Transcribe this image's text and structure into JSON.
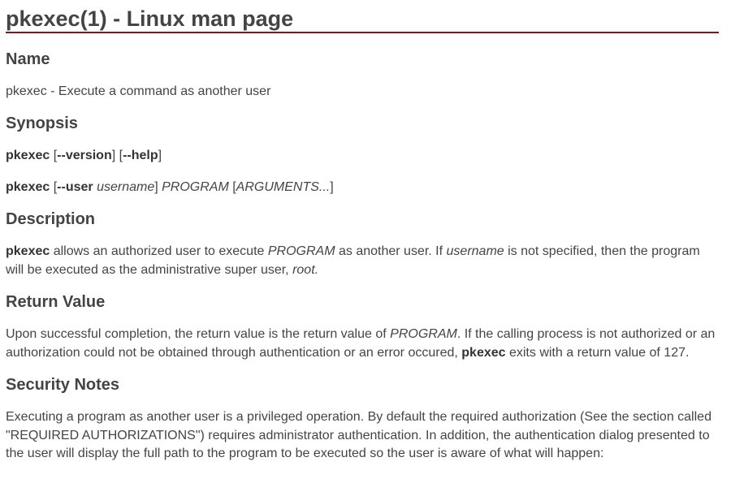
{
  "title": "pkexec(1) - Linux man page",
  "sections": {
    "name": {
      "heading": "Name",
      "text": "pkexec - Execute a command as another user"
    },
    "synopsis": {
      "heading": "Synopsis",
      "line1": {
        "cmd": "pkexec",
        "open1": " [",
        "opt1": "--version",
        "mid": "] [",
        "opt2": "--help",
        "close": "]"
      },
      "line2": {
        "cmd": "pkexec",
        "open1": " [",
        "opt_user": "--user",
        "space": " ",
        "arg_username": "username",
        "close1": "] ",
        "arg_program": "PROGRAM",
        "open2": " [",
        "arg_arguments": "ARGUMENTS...",
        "close2": "]"
      }
    },
    "description": {
      "heading": "Description",
      "cmd": "pkexec",
      "t1": " allows an authorized user to execute ",
      "program": "PROGRAM",
      "t2": " as another user. If ",
      "username": "username",
      "t3": " is not specified, then the program will be executed as the administrative super user, ",
      "root": "root."
    },
    "return_value": {
      "heading": "Return Value",
      "t1": "Upon successful completion, the return value is the return value of ",
      "program": "PROGRAM",
      "t2": ". If the calling process is not authorized or an authorization could not be obtained through authentication or an error occured, ",
      "cmd": "pkexec",
      "t3": " exits with a return value of 127."
    },
    "security_notes": {
      "heading": "Security Notes",
      "text": "Executing a program as another user is a privileged operation. By default the required authorization (See the section called \"REQUIRED AUTHORIZATIONS\") requires administrator authentication. In addition, the authentication dialog presented to the user will display the full path to the program to be executed so the user is aware of what will happen:"
    }
  }
}
